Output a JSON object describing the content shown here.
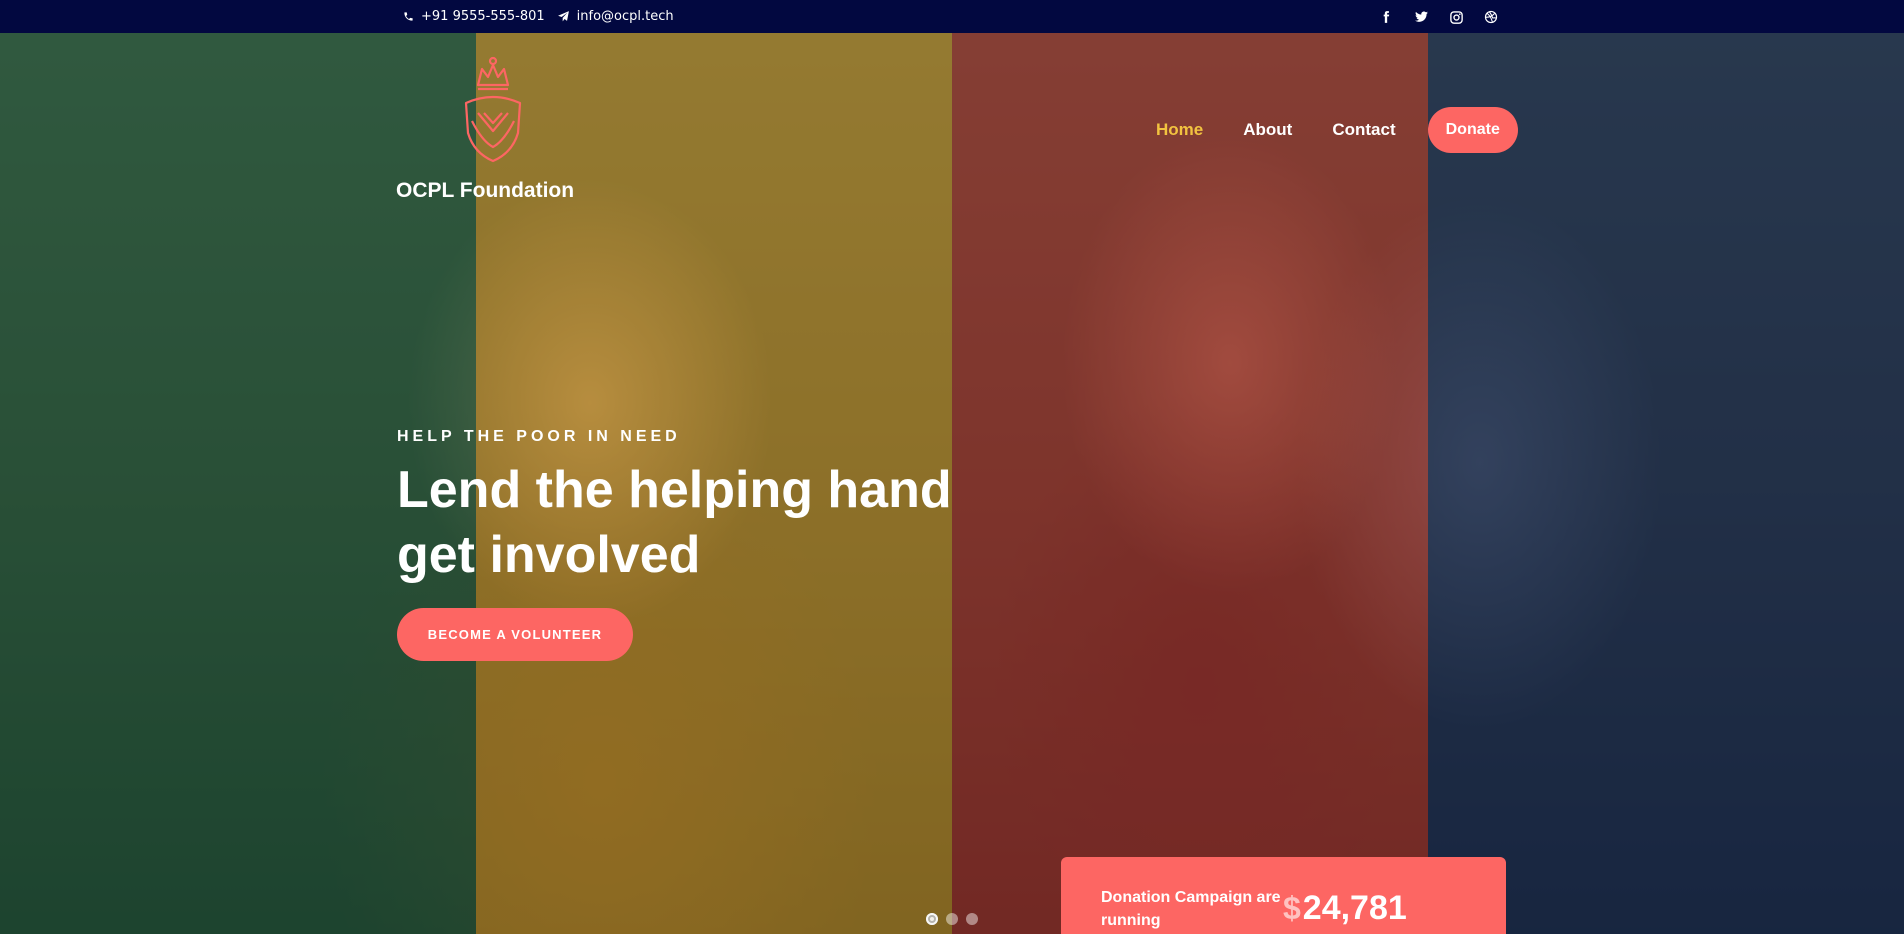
{
  "topbar": {
    "phone": "+91 9555-555-801",
    "email": "info@ocpl.tech",
    "social": [
      "facebook-icon",
      "twitter-icon",
      "instagram-icon",
      "dribbble-icon"
    ]
  },
  "brand": {
    "name": "OCPL Foundation",
    "accent": "#fd6663",
    "active_nav": "#f2c340",
    "topbar_bg": "#020840"
  },
  "nav": {
    "home": "Home",
    "about": "About",
    "contact": "Contact",
    "donate": "Donate"
  },
  "hero": {
    "eyebrow": "HELP THE POOR IN NEED",
    "headline": "Lend the helping hand get involved",
    "cta": "BECOME A VOLUNTEER",
    "slides": 3,
    "active_slide": 1
  },
  "donation": {
    "label": "Donation Campaign are running",
    "currency": "$",
    "amount": "24,781"
  }
}
